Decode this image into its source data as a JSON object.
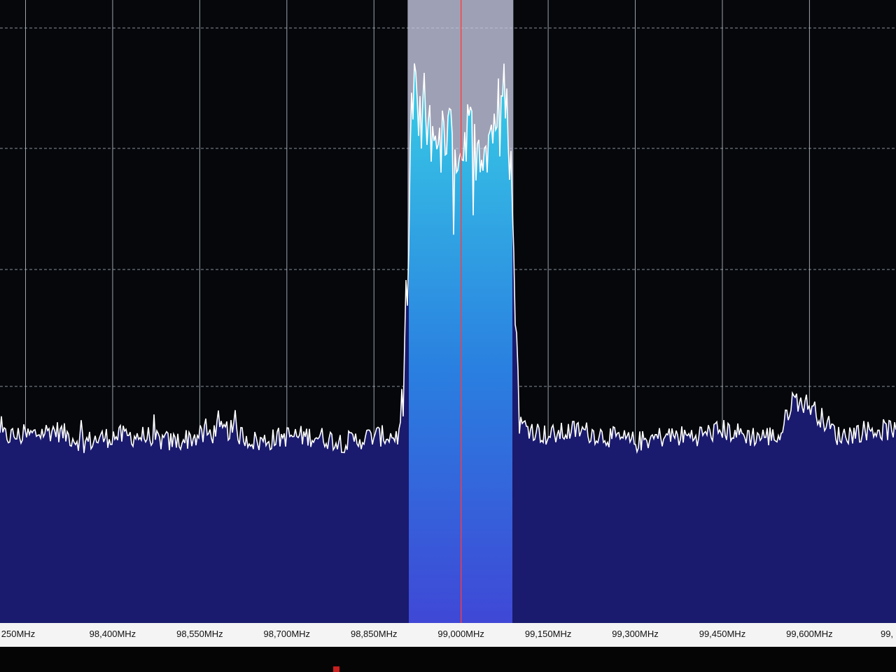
{
  "screen": {
    "name": "fft-spectrum-view"
  },
  "colors": {
    "background": "#05070b",
    "grid": "#b8c0c8",
    "noise_fill": "#1a1a6e",
    "signal_fill_low": "#3f48d6",
    "signal_fill_high": "#38d0e6",
    "trace": "#ffffff",
    "passband_overlay": "#c9cde6",
    "center_line": "#ff3b3b",
    "axis_background": "#f4f4f4",
    "axis_text": "#111111",
    "marker": "#c8201e"
  },
  "frequency_axis": {
    "labels": [
      {
        "text": "250MHz",
        "value": 98250
      },
      {
        "text": "98,400MHz",
        "value": 98400
      },
      {
        "text": "98,550MHz",
        "value": 98550
      },
      {
        "text": "98,700MHz",
        "value": 98700
      },
      {
        "text": "98,850MHz",
        "value": 98850
      },
      {
        "text": "99,000MHz",
        "value": 99000
      },
      {
        "text": "99,150MHz",
        "value": 99150
      },
      {
        "text": "99,300MHz",
        "value": 99300
      },
      {
        "text": "99,450MHz",
        "value": 99450
      },
      {
        "text": "99,600MHz",
        "value": 99600
      },
      {
        "text": "99,",
        "value": 99750
      }
    ],
    "min_khz": 98206,
    "max_khz": 99749
  },
  "tuning": {
    "center_khz": 99000,
    "passband_low_khz": 98908,
    "passband_high_khz": 99090
  },
  "chart_data": {
    "type": "area",
    "x_unit": "kHz",
    "series": [
      {
        "x": [
          98250,
          98300,
          98350,
          98400,
          98450,
          98500,
          98550,
          98600,
          98650,
          98700,
          98750,
          98800,
          98850,
          98895,
          98905,
          98915,
          98925,
          98935,
          98945,
          98955,
          98965,
          98975,
          98985,
          98995,
          99005,
          99015,
          99025,
          99035,
          99045,
          99055,
          99065,
          99075,
          99085,
          99095,
          99100,
          99150,
          99200,
          99250,
          99300,
          99350,
          99400,
          99450,
          99500,
          99550,
          99570,
          99600,
          99650,
          99700
        ],
        "y": [
          0.3,
          0.31,
          0.29,
          0.3,
          0.3,
          0.29,
          0.3,
          0.31,
          0.29,
          0.3,
          0.3,
          0.29,
          0.3,
          0.3,
          0.58,
          0.84,
          0.91,
          0.86,
          0.83,
          0.81,
          0.8,
          0.8,
          0.81,
          0.8,
          0.8,
          0.81,
          0.8,
          0.8,
          0.81,
          0.83,
          0.86,
          0.88,
          0.78,
          0.52,
          0.32,
          0.3,
          0.31,
          0.3,
          0.29,
          0.3,
          0.3,
          0.31,
          0.3,
          0.3,
          0.36,
          0.35,
          0.3,
          0.31
        ]
      }
    ]
  }
}
